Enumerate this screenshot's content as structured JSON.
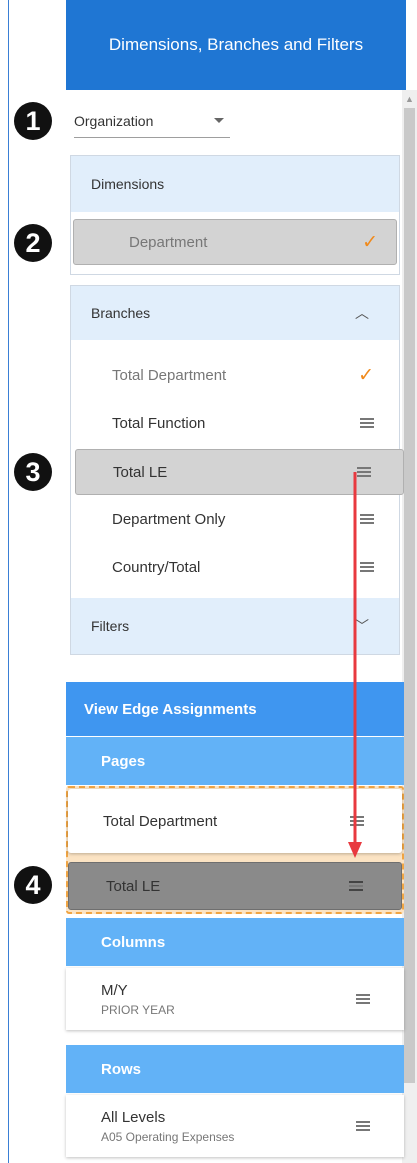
{
  "header": {
    "title": "Dimensions, Branches and Filters"
  },
  "markers": [
    "1",
    "2",
    "3",
    "4"
  ],
  "organization": {
    "selected": "Organization"
  },
  "dimensions": {
    "header": "Dimensions",
    "items": [
      {
        "label": "Department",
        "checked": true
      }
    ]
  },
  "branches": {
    "header": "Branches",
    "items": [
      {
        "label": "Total Department",
        "state": "checked"
      },
      {
        "label": "Total Function",
        "state": "handle"
      },
      {
        "label": "Total LE",
        "state": "dragging"
      },
      {
        "label": "Department Only",
        "state": "handle"
      },
      {
        "label": "Country/Total",
        "state": "handle"
      }
    ]
  },
  "filters": {
    "header": "Filters"
  },
  "edge": {
    "title": "View Edge Assignments",
    "pages": {
      "header": "Pages",
      "items": [
        {
          "label": "Total Department"
        },
        {
          "label": "Total LE"
        }
      ]
    },
    "columns": {
      "header": "Columns",
      "items": [
        {
          "label": "M/Y",
          "sub": "PRIOR YEAR"
        }
      ]
    },
    "rows": {
      "header": "Rows",
      "items": [
        {
          "label": "All Levels",
          "sub": "A05 Operating Expenses"
        }
      ]
    }
  },
  "colors": {
    "header_blue": "#1f76d3",
    "edge_blue": "#3f96f0",
    "section_blue": "#62b2f7",
    "check_orange": "#f08a1c",
    "drag_arrow": "#e8393f",
    "drop_zone": "#f0a544"
  },
  "icons": [
    "caret-down-icon",
    "checkmark-icon",
    "drag-handle-icon",
    "chevron-up-icon",
    "chevron-down-icon",
    "drag-arrow-icon"
  ]
}
